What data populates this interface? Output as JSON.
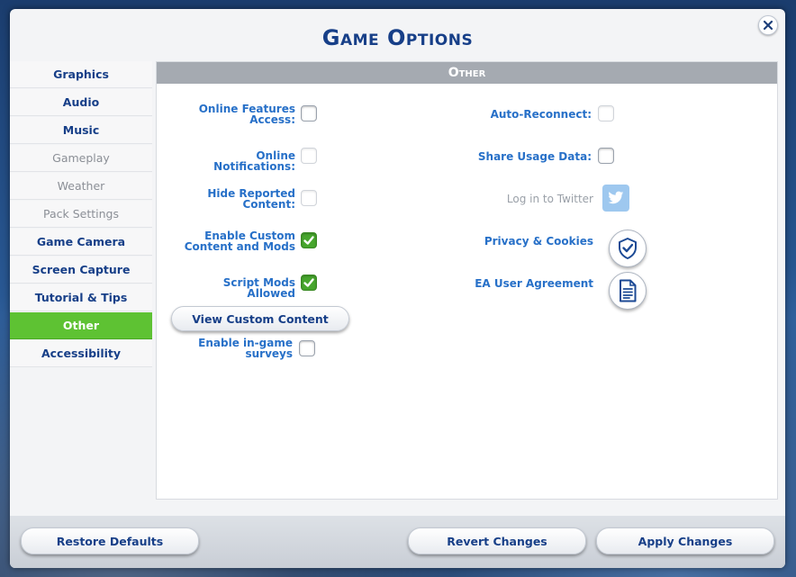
{
  "dialog": {
    "title": "Game Options",
    "close_icon": "close-icon"
  },
  "sidebar": {
    "items": [
      {
        "label": "Graphics",
        "state": "normal"
      },
      {
        "label": "Audio",
        "state": "normal"
      },
      {
        "label": "Music",
        "state": "normal"
      },
      {
        "label": "Gameplay",
        "state": "disabled"
      },
      {
        "label": "Weather",
        "state": "disabled"
      },
      {
        "label": "Pack Settings",
        "state": "disabled"
      },
      {
        "label": "Game Camera",
        "state": "normal"
      },
      {
        "label": "Screen Capture",
        "state": "normal"
      },
      {
        "label": "Tutorial & Tips",
        "state": "normal"
      },
      {
        "label": "Other",
        "state": "active"
      },
      {
        "label": "Accessibility",
        "state": "normal"
      }
    ]
  },
  "panel": {
    "header": "Other",
    "left_options": [
      {
        "label": "Online Features Access:",
        "checked": false,
        "enabled": true
      },
      {
        "label": "Online Notifications:",
        "checked": false,
        "enabled": false
      },
      {
        "label": "Hide Reported Content:",
        "checked": false,
        "enabled": false
      },
      {
        "label": "Enable Custom Content and Mods",
        "checked": true,
        "enabled": true
      },
      {
        "label": "Script Mods Allowed",
        "checked": true,
        "enabled": true
      },
      {
        "label": "Enable in-game surveys",
        "checked": false,
        "enabled": true
      }
    ],
    "view_custom_content": "View Custom Content",
    "right_options": {
      "auto_reconnect": {
        "label": "Auto-Reconnect:",
        "checked": false
      },
      "share_usage": {
        "label": "Share Usage Data:",
        "checked": false
      },
      "twitter": {
        "label": "Log in to Twitter",
        "icon": "twitter-icon"
      },
      "privacy": {
        "label": "Privacy & Cookies",
        "icon": "shield-check-icon"
      },
      "ea_agreement": {
        "label": "EA User Agreement",
        "icon": "document-icon"
      }
    }
  },
  "footer": {
    "restore_defaults": "Restore Defaults",
    "revert_changes": "Revert Changes",
    "apply_changes": "Apply Changes"
  },
  "colors": {
    "accent_green": "#5ec233",
    "title_blue": "#173f88",
    "option_blue": "#2770c8"
  }
}
